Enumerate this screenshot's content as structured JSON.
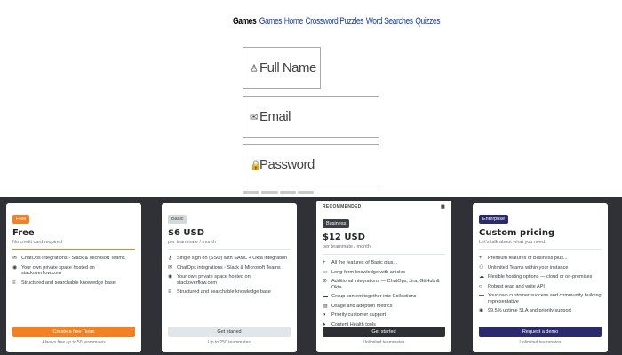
{
  "nav": {
    "brand": "Games",
    "links": [
      "Games",
      "Home",
      "Crossword Puzzles",
      "Word Searches",
      "Quizzes"
    ]
  },
  "form": {
    "name_placeholder": "Full Name",
    "email_placeholder": "Email",
    "password_placeholder": "Password"
  },
  "plans": [
    {
      "tag": "Free",
      "title": "Free",
      "subtitle": "No credit card required",
      "features": [
        {
          "icon": "chat-icon",
          "glyph": "✉",
          "text": "ChatOps integrations - Slack & Microsoft Teams"
        },
        {
          "icon": "eye-icon",
          "glyph": "◉",
          "text": "Your own private space hosted on stackoverflow.com"
        },
        {
          "icon": "list-icon",
          "glyph": "≡",
          "text": "Structured and searchable knowledge base"
        }
      ],
      "cta": "Create a free Team",
      "note": "Always free up to 50 teammates"
    },
    {
      "tag": "Basic",
      "title": "$6 USD",
      "subtitle": "per teammate / month",
      "features": [
        {
          "icon": "key-icon",
          "glyph": "⚷",
          "text": "Single sign on (SSO) with SAML + Okta integration"
        },
        {
          "icon": "chat-icon",
          "glyph": "✉",
          "text": "ChatOps integrations - Slack & Microsoft Teams"
        },
        {
          "icon": "eye-icon",
          "glyph": "◉",
          "text": "Your own private space hosted on stackoverflow.com"
        },
        {
          "icon": "list-icon",
          "glyph": "≡",
          "text": "Structured and searchable knowledge base"
        }
      ],
      "cta": "Get started",
      "note": "Up to 250 teammates"
    },
    {
      "recommended": "RECOMMENDED",
      "tag": "Business",
      "title": "$12 USD",
      "subtitle": "per teammate / month",
      "features": [
        {
          "icon": "plus-icon",
          "glyph": "+",
          "text": "All the features of Basic plus..."
        },
        {
          "icon": "book-icon",
          "glyph": "▭",
          "text": "Long-form knowledge with articles"
        },
        {
          "icon": "link-icon",
          "glyph": "⊘",
          "text": "Additional integrations — ChatOps, Jira, GitHub & Okta"
        },
        {
          "icon": "folder-icon",
          "glyph": "▬",
          "text": "Group content together into Collections"
        },
        {
          "icon": "chart-icon",
          "glyph": "▤",
          "text": "Usage and adoption metrics"
        },
        {
          "icon": "support-icon",
          "glyph": "◑",
          "text": "Priority customer support"
        },
        {
          "icon": "heart-icon",
          "glyph": "♠",
          "text": "Content Health tools"
        }
      ],
      "cta": "Get started",
      "note": "Unlimited teammates"
    },
    {
      "tag": "Enterprise",
      "title": "Custom pricing",
      "subtitle": "Let's talk about what you need",
      "features": [
        {
          "icon": "plus-icon",
          "glyph": "+",
          "text": "Premium features of Business plus..."
        },
        {
          "icon": "users-icon",
          "glyph": "⚇",
          "text": "Unlimited Teams within your instance"
        },
        {
          "icon": "cloud-icon",
          "glyph": "☁",
          "text": "Flexible hosting options — cloud or on-premises"
        },
        {
          "icon": "code-icon",
          "glyph": "‹›",
          "text": "Robust read and write API"
        },
        {
          "icon": "rep-icon",
          "glyph": "▬",
          "text": "Your own customer success and community building representative"
        },
        {
          "icon": "uptime-icon",
          "glyph": "◉",
          "text": "99.5% uptime SLA and priority support"
        }
      ],
      "cta": "Request a demo",
      "note": "Unlimited teammates"
    }
  ],
  "colors": {
    "band": "#2f3136",
    "free_accent": "#f48024",
    "enterprise_accent": "#2a2a6c",
    "link": "#1a3fbf"
  }
}
